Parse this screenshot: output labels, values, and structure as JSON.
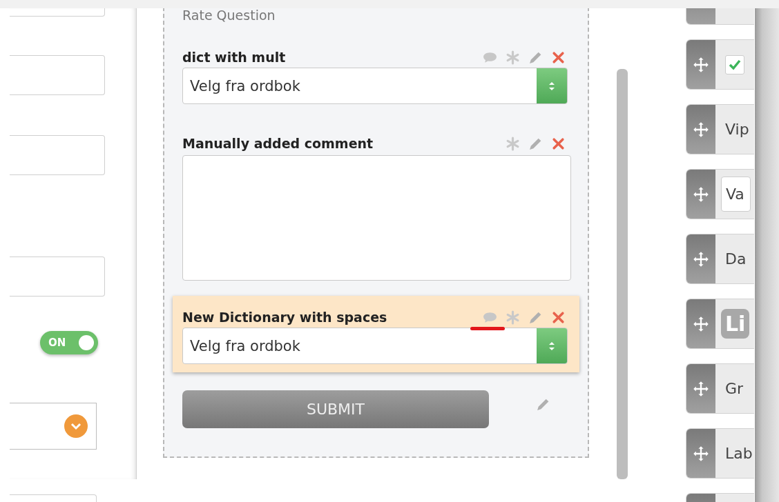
{
  "left_panel": {
    "toggle": {
      "label": "ON",
      "on": true
    }
  },
  "form": {
    "title": "Rate Question",
    "questions": [
      {
        "kind": "select",
        "label": "dict with mult",
        "value": "Velg fra ordbok",
        "comment_icon": true,
        "selected": false,
        "annotated": false
      },
      {
        "kind": "textarea",
        "label": "Manually added comment",
        "comment_icon": false,
        "selected": false,
        "annotated": false
      },
      {
        "kind": "select",
        "label": "New Dictionary with spaces",
        "value": "Velg fra ordbok",
        "comment_icon": true,
        "selected": true,
        "annotated": true
      }
    ],
    "submit": {
      "label": "SUBMIT"
    }
  },
  "palette": [
    {
      "kind": "blank"
    },
    {
      "kind": "checkbox",
      "checked": true
    },
    {
      "kind": "text",
      "label": "Vip"
    },
    {
      "kind": "input",
      "value": "Va"
    },
    {
      "kind": "text",
      "label": "Da"
    },
    {
      "kind": "badge",
      "label": "Li"
    },
    {
      "kind": "text",
      "label": "Gr"
    },
    {
      "kind": "text",
      "label": "Lab"
    },
    {
      "kind": "blank"
    }
  ]
}
